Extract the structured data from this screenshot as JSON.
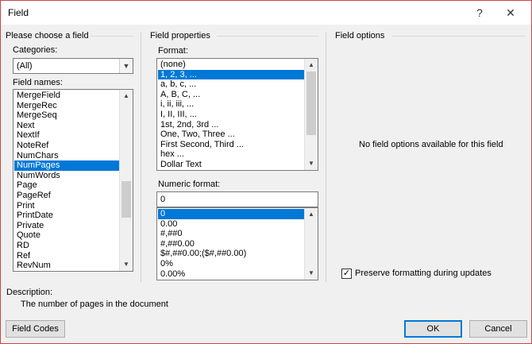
{
  "dialog": {
    "title": "Field",
    "help_glyph": "?",
    "close_glyph": "✕"
  },
  "left_group": {
    "title": "Please choose a field",
    "categories_label": "Categories:",
    "categories_value": "(All)",
    "field_names_label": "Field names:",
    "field_names": [
      "MergeField",
      "MergeRec",
      "MergeSeq",
      "Next",
      "NextIf",
      "NoteRef",
      "NumChars",
      "NumPages",
      "NumWords",
      "Page",
      "PageRef",
      "Print",
      "PrintDate",
      "Private",
      "Quote",
      "RD",
      "Ref",
      "RevNum"
    ],
    "selected_field": "NumPages"
  },
  "middle_group": {
    "title": "Field properties",
    "format_label": "Format:",
    "formats": [
      "(none)",
      "1, 2, 3, ...",
      "a, b, c, ...",
      "A, B, C, ...",
      "i, ii, iii, ...",
      "I, II, III, ...",
      "1st, 2nd, 3rd ...",
      "One, Two, Three ...",
      "First Second, Third ...",
      "hex ...",
      "Dollar Text"
    ],
    "selected_format": "1, 2, 3, ...",
    "numeric_format_label": "Numeric format:",
    "numeric_format_value": "0",
    "numeric_formats": [
      "0",
      "0.00",
      "#,##0",
      "#,##0.00",
      "$#,##0.00;($#,##0.00)",
      "0%",
      "0.00%"
    ],
    "selected_numeric_format": "0"
  },
  "right_group": {
    "title": "Field options",
    "message": "No field options available for this field",
    "preserve_label": "Preserve formatting during updates",
    "preserve_checked": true
  },
  "description": {
    "label": "Description:",
    "text": "The number of pages in the document"
  },
  "buttons": {
    "field_codes": "Field Codes",
    "ok": "OK",
    "cancel": "Cancel"
  },
  "colors": {
    "selection": "#0078d7",
    "window_border": "#cc4444"
  }
}
